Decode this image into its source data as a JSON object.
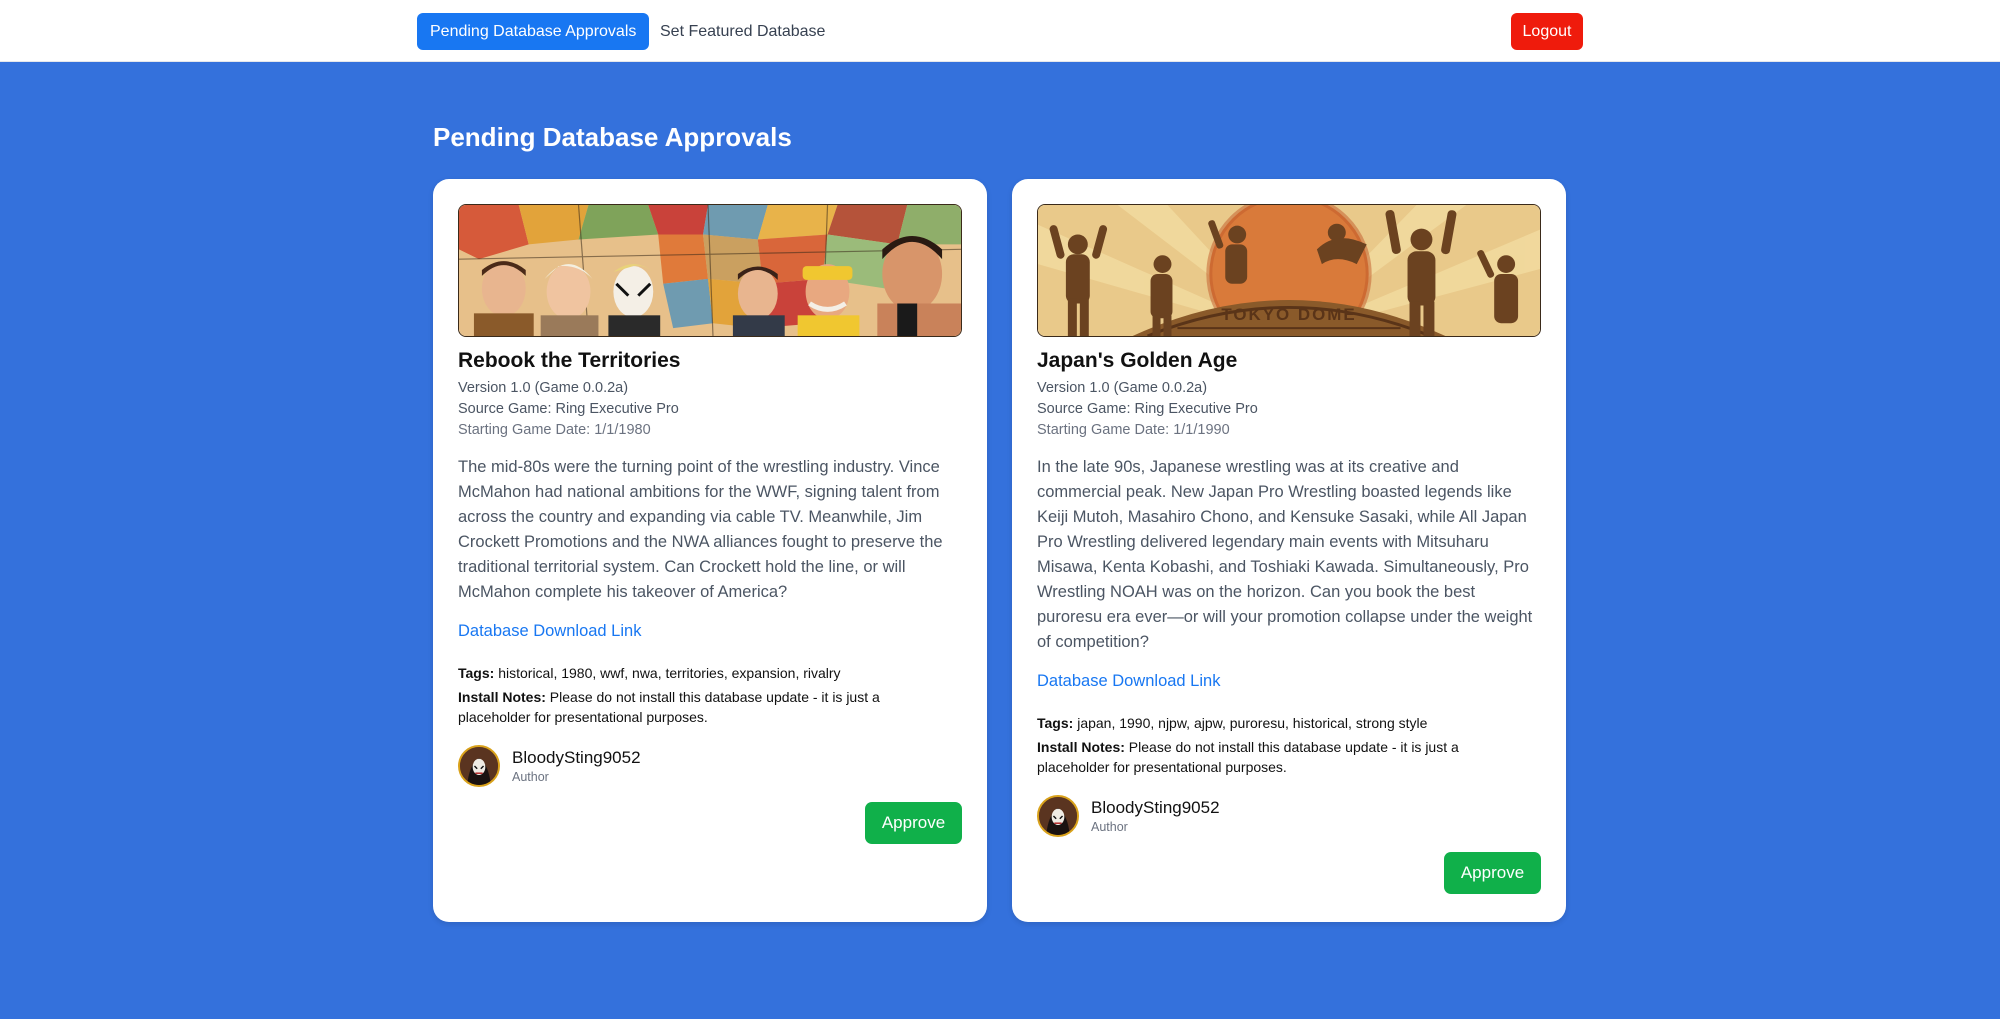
{
  "nav": {
    "pending_label": "Pending Database Approvals",
    "featured_label": "Set Featured Database",
    "logout_label": "Logout"
  },
  "page_title": "Pending Database Approvals",
  "cards": [
    {
      "banner_icon": "wrestling-territories-banner-image",
      "title": "Rebook the Territories",
      "version": "Version 1.0 (Game 0.0.2a)",
      "source_game": "Source Game: Ring Executive Pro",
      "start_date": "Starting Game Date: 1/1/1980",
      "description": "The mid-80s were the turning point of the wrestling industry. Vince McMahon had national ambitions for the WWF, signing talent from across the country and expanding via cable TV. Meanwhile, Jim Crockett Promotions and the NWA alliances fought to preserve the traditional territorial system. Can Crockett hold the line, or will McMahon complete his takeover of America?",
      "download_label": "Database Download Link",
      "tags_label": "Tags:",
      "tags": "historical, 1980, wwf, nwa, territories, expansion, rivalry",
      "notes_label": "Install Notes:",
      "notes": "Please do not install this database update - it is just a placeholder for presentational purposes.",
      "author_name": "BloodySting9052",
      "author_role": "Author",
      "approve_label": "Approve"
    },
    {
      "banner_icon": "tokyo-dome-banner-image",
      "banner_text": "TOKYO DOME",
      "title": "Japan's Golden Age",
      "version": "Version 1.0 (Game 0.0.2a)",
      "source_game": "Source Game: Ring Executive Pro",
      "start_date": "Starting Game Date: 1/1/1990",
      "description": "In the late 90s, Japanese wrestling was at its creative and commercial peak. New Japan Pro Wrestling boasted legends like Keiji Mutoh, Masahiro Chono, and Kensuke Sasaki, while All Japan Pro Wrestling delivered legendary main events with Mitsuharu Misawa, Kenta Kobashi, and Toshiaki Kawada. Simultaneously, Pro Wrestling NOAH was on the horizon. Can you book the best puroresu era ever—or will your promotion collapse under the weight of competition?",
      "download_label": "Database Download Link",
      "tags_label": "Tags:",
      "tags": "japan, 1990, njpw, ajpw, puroresu, historical, strong style",
      "notes_label": "Install Notes:",
      "notes": "Please do not install this database update - it is just a placeholder for presentational purposes.",
      "author_name": "BloodySting9052",
      "author_role": "Author",
      "approve_label": "Approve"
    }
  ],
  "colors": {
    "background": "#3471dc",
    "primary": "#1877f2",
    "danger": "#ef1b0c",
    "success": "#10b04a"
  }
}
